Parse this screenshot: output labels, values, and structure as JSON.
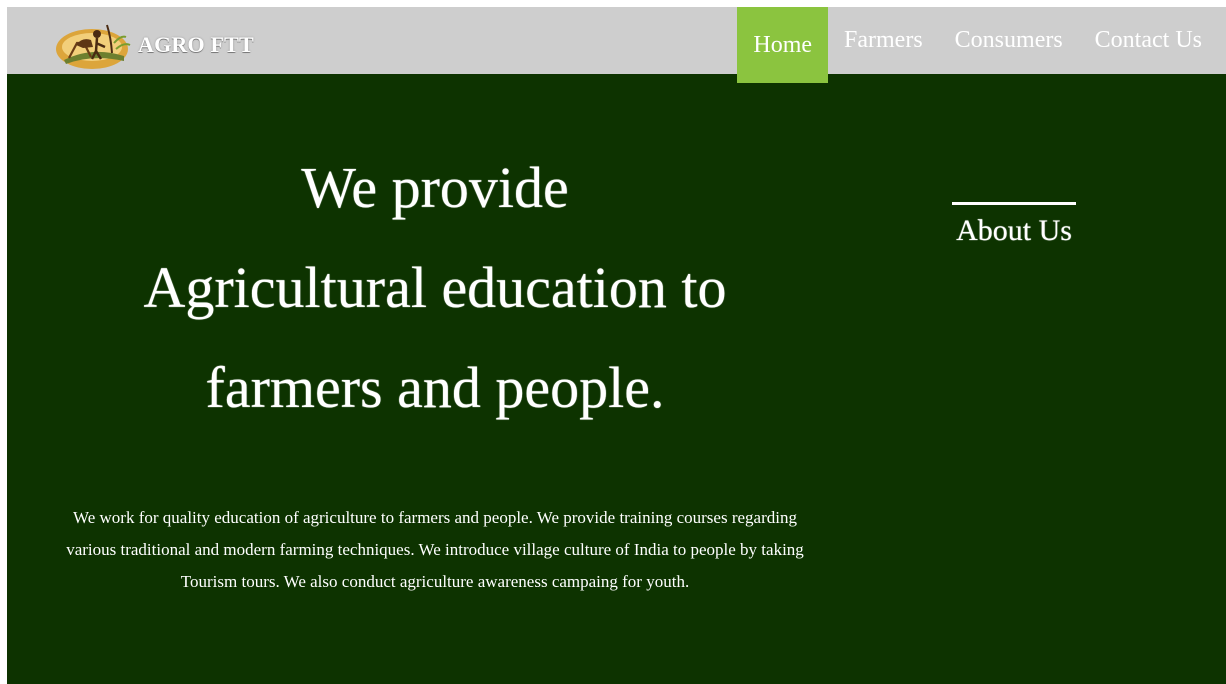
{
  "brand": {
    "name": "AGRO FTT",
    "logo_icon": "farmer-plowing-logo"
  },
  "nav": {
    "items": [
      {
        "label": "Home",
        "active": true
      },
      {
        "label": "Farmers",
        "active": false
      },
      {
        "label": "Consumers",
        "active": false
      },
      {
        "label": "Contact Us",
        "active": false
      }
    ],
    "active_color": "#8bc43f",
    "bar_color": "#cecece"
  },
  "hero": {
    "lines": [
      "We provide",
      "Agricultural education to",
      "farmers and people."
    ]
  },
  "about": {
    "heading": "About Us"
  },
  "description": "We work for quality education of agriculture to farmers and people. We provide training courses regarding various traditional and modern farming techniques. We introduce village culture of India to people by taking Tourism tours. We also conduct agriculture awareness campaing for youth.",
  "colors": {
    "background": "#0d3300",
    "text": "#ffffff"
  }
}
